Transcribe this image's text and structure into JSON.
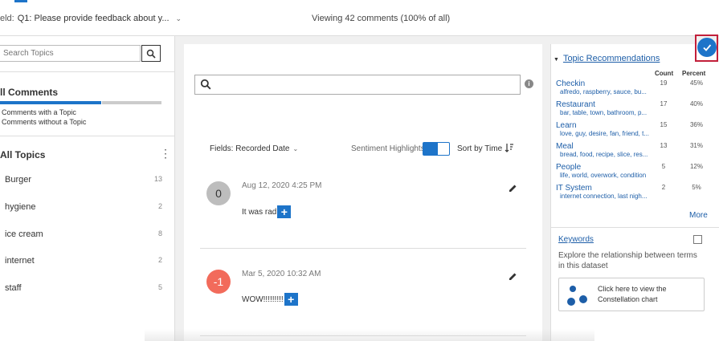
{
  "header": {
    "field_label": "eld:",
    "field_value": "Q1: Please provide feedback about y...",
    "viewing": "Viewing 42 comments (100% of all)"
  },
  "left": {
    "search_placeholder": "Search Topics",
    "all_comments": "ll Comments",
    "comments_with_topic": "Comments with a Topic",
    "comments_without_topic": "Comments without a Topic",
    "with_topic_fraction": 0.63,
    "all_topics": "All Topics",
    "topics": [
      {
        "name": "Burger",
        "count": "13"
      },
      {
        "name": "hygiene",
        "count": "2"
      },
      {
        "name": "ice cream",
        "count": "8"
      },
      {
        "name": "internet",
        "count": "2"
      },
      {
        "name": "staff",
        "count": "5"
      }
    ]
  },
  "center": {
    "search_value": "",
    "fields_label": "Fields: Recorded Date",
    "sentiment_label": "Sentiment Highlights",
    "sentiment_on": true,
    "sort_label": "Sort by Time",
    "comments": [
      {
        "score": "0",
        "timestamp": "Aug 12, 2020 4:25 PM",
        "text": "It was rad",
        "sentiment": "neutral"
      },
      {
        "score": "-1",
        "timestamp": "Mar 5, 2020 10:32 AM",
        "text": "WOW!!!!!!!!!",
        "sentiment": "negative"
      }
    ]
  },
  "right": {
    "title": "Topic Recommendations",
    "col_count": "Count",
    "col_percent": "Percent",
    "recommendations": [
      {
        "name": "Checkin",
        "keywords": "alfredo, raspberry, sauce, bu...",
        "count": "19",
        "percent": "45%"
      },
      {
        "name": "Restaurant",
        "keywords": "bar, table, town, bathroom, p...",
        "count": "17",
        "percent": "40%"
      },
      {
        "name": "Learn",
        "keywords": "love, guy, desire, fan, friend, t...",
        "count": "15",
        "percent": "36%"
      },
      {
        "name": "Meal",
        "keywords": "bread, food, recipe, slice, res...",
        "count": "13",
        "percent": "31%"
      },
      {
        "name": "People",
        "keywords": "life, world, overwork, condition",
        "count": "5",
        "percent": "12%"
      },
      {
        "name": "IT System",
        "keywords": "internet connection, last nigh...",
        "count": "2",
        "percent": "5%"
      }
    ],
    "more": "More",
    "keywords_title": "Keywords",
    "explore_text": "Explore the relationship between terms in this dataset",
    "constellation_text": "Click here to view the Constellation chart"
  },
  "colors": {
    "accent": "#1d74c9",
    "negative": "#f26b5b",
    "neutral": "#bdbdbd",
    "highlight_frame": "#c21f3a"
  }
}
